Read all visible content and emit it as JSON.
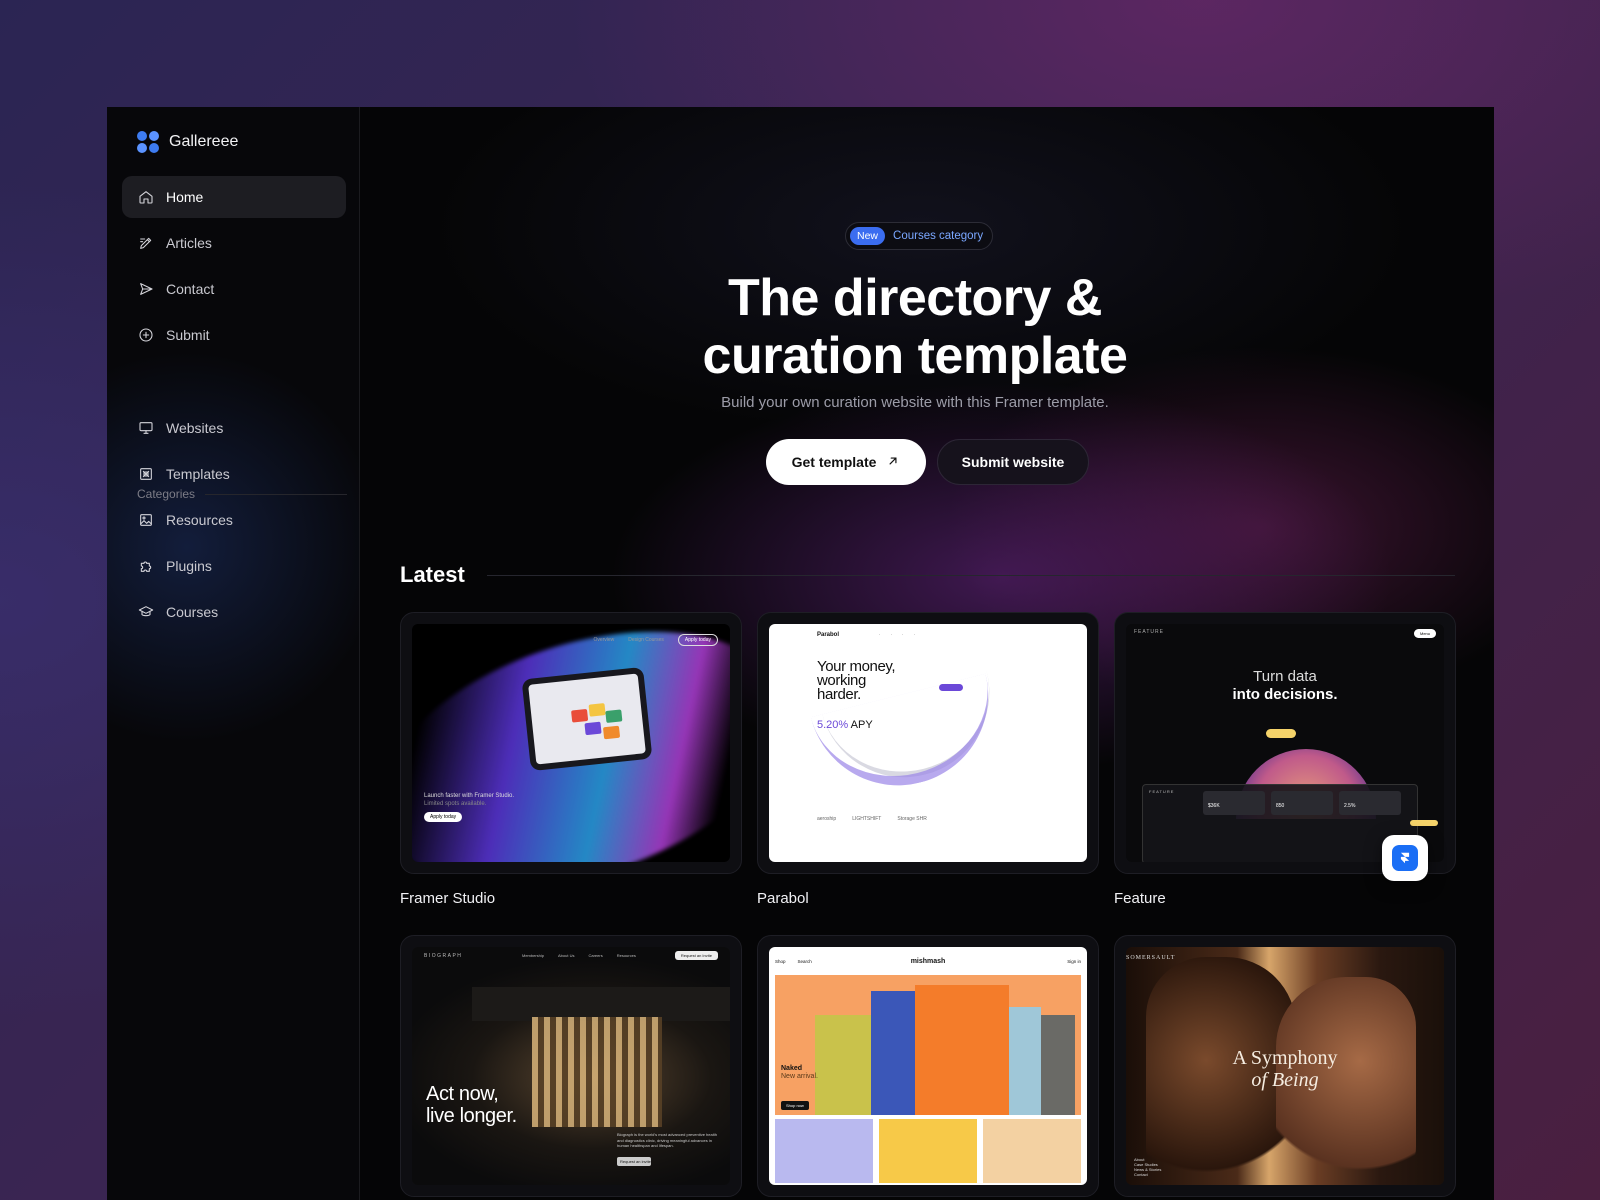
{
  "brand": {
    "name": "Gallereee"
  },
  "nav": [
    {
      "label": "Home",
      "icon": "home-icon",
      "active": true
    },
    {
      "label": "Articles",
      "icon": "pencil-icon"
    },
    {
      "label": "Contact",
      "icon": "send-icon"
    },
    {
      "label": "Submit",
      "icon": "plus-circle-icon"
    }
  ],
  "categories": {
    "label": "Categories",
    "items": [
      {
        "label": "Websites",
        "icon": "monitor-icon"
      },
      {
        "label": "Templates",
        "icon": "template-icon"
      },
      {
        "label": "Resources",
        "icon": "image-icon"
      },
      {
        "label": "Plugins",
        "icon": "puzzle-icon"
      },
      {
        "label": "Courses",
        "icon": "graduation-cap-icon"
      }
    ]
  },
  "hero": {
    "badge_new": "New",
    "badge_text": "Courses category",
    "title_line1": "The directory &",
    "title_line2": "curation template",
    "subtitle": "Build your own curation website with this Framer template.",
    "primary_button": "Get template",
    "secondary_button": "Submit website"
  },
  "latest": {
    "title": "Latest",
    "cards": [
      {
        "title": "Framer Studio",
        "thumb": {
          "nav": [
            "Overview",
            "Design Courses"
          ],
          "nav_button": "Apply today",
          "caption_line1": "Launch faster with Framer Studio.",
          "caption_line2": "Limited spots available.",
          "caption_button": "Apply today"
        }
      },
      {
        "title": "Parabol",
        "thumb": {
          "logo": "Parabol",
          "headline_line1": "Your money,",
          "headline_line2": "working",
          "headline_line3": "harder.",
          "apy_value": "5.20%",
          "apy_label": "APY",
          "logos": [
            "aeroship",
            "LIGHTSHIFT",
            "Storage SHR"
          ]
        }
      },
      {
        "title": "Feature",
        "thumb": {
          "brand": "FEATURE",
          "menu": "Menu",
          "headline_line1": "Turn data",
          "headline_line2": "into decisions.",
          "stats": [
            "$36K",
            "850",
            "2.5%"
          ],
          "side_label": "FEATURE"
        }
      },
      {
        "title": "",
        "thumb": {
          "brand": "BIOGRAPH",
          "nav": [
            "Membership",
            "About Us",
            "Careers",
            "Resources"
          ],
          "nav_button": "Request an Invite",
          "headline_line1": "Act now,",
          "headline_line2": "live longer.",
          "paragraph": "Biograph is the world's most advanced preventive health and diagnostics clinic, driving meaningful advances in human healthspan and lifespan.",
          "button": "Request an invite"
        }
      },
      {
        "title": "",
        "thumb": {
          "nav_left": [
            "Shop",
            "Search"
          ],
          "logo": "mishmash",
          "nav_right": "Sign in",
          "label_line1": "Naked",
          "label_line2": "New arrival.",
          "shop_button": "Shop now"
        }
      },
      {
        "title": "",
        "thumb": {
          "brand": "SOMERSAULT",
          "headline_line1": "A Symphony",
          "headline_line2": "of Being",
          "list": [
            "About",
            "Case Studies",
            "News & Stories",
            "Contact"
          ]
        }
      }
    ]
  },
  "colors": {
    "accent": "#3b6df0",
    "badge_text": "#7aa7ff",
    "frame_bg": "#050506"
  }
}
